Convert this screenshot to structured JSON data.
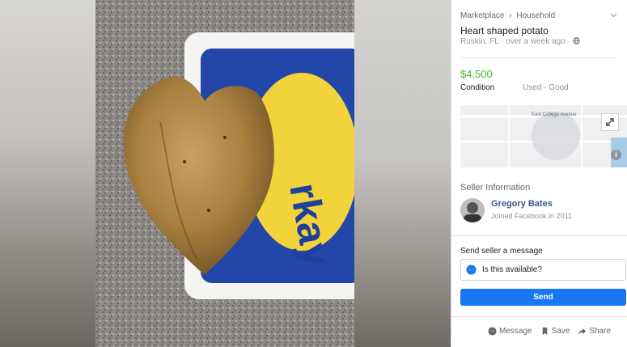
{
  "breadcrumb": {
    "item1": "Marketplace",
    "sep": "›",
    "item2": "Household"
  },
  "listing": {
    "title": "Heart shaped potato",
    "location": "Ruskin, FL",
    "time": "over a week ago",
    "price": "$4,500",
    "condition_label": "Condition",
    "condition_value": "Used - Good"
  },
  "map": {
    "street": "East College Avenue"
  },
  "seller": {
    "section_title": "Seller Information",
    "name": "Gregory Bates",
    "joined": "Joined Facebook in 2011"
  },
  "message": {
    "label": "Send seller a message",
    "input_value": "Is this available?",
    "send_label": "Send"
  },
  "actions": {
    "message": "Message",
    "save": "Save",
    "share": "Share"
  },
  "colors": {
    "price": "#42b72a",
    "send": "#1877f2",
    "seller_name": "#385898"
  }
}
